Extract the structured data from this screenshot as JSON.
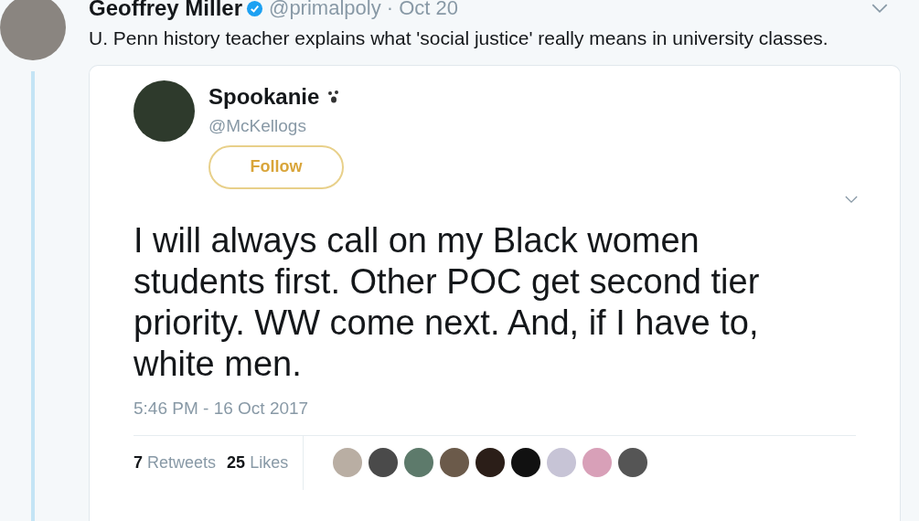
{
  "tweet": {
    "author": "Geoffrey Miller",
    "verified": true,
    "meta": "@primalpoly · Oct 20",
    "text": "U. Penn history teacher explains what 'social justice' really means in university classes.",
    "quoted": {
      "name": "Spookanie",
      "handle": "@McKellogs",
      "follow_button": "Follow",
      "text": "I will always call on my Black women students first. Other POC get second tier priority. WW come next. And, if I have to, white men.",
      "timestamp": "5:46 PM - 16 Oct 2017",
      "retweets": {
        "count": "7",
        "label": "Retweets"
      },
      "likes": {
        "count": "25",
        "label": "Likes"
      }
    }
  }
}
